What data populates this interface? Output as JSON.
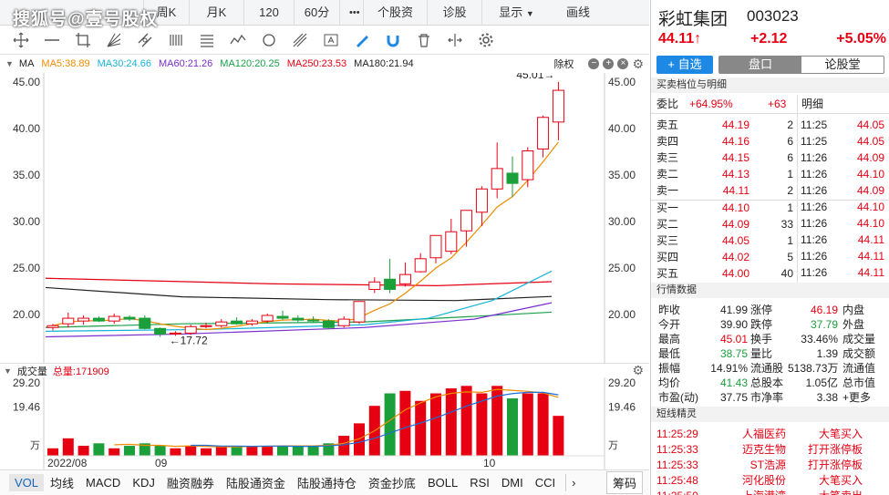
{
  "watermark": "搜狐号@壹号股权",
  "top_tabs": [
    "周K",
    "月K",
    "120分",
    "60分",
    "•••",
    "个股资料",
    "诊股",
    "显示",
    "画线"
  ],
  "ma_legend": [
    {
      "label": "MA",
      "color": "#222"
    },
    {
      "label": "MA5:38.89",
      "color": "#f08c00"
    },
    {
      "label": "MA30:24.66",
      "color": "#16b3d6"
    },
    {
      "label": "MA60:21.26",
      "color": "#7b2fd0"
    },
    {
      "label": "MA120:20.25",
      "color": "#1aa04a"
    },
    {
      "label": "MA250:23.53",
      "color": "#e60012"
    },
    {
      "label": "MA180:21.94",
      "color": "#222"
    }
  ],
  "chu_quan": "除权",
  "price_axis": [
    "45.00",
    "40.00",
    "35.00",
    "30.00",
    "25.00",
    "20.00"
  ],
  "annot_high": "45.01→",
  "annot_low": "←17.72",
  "vol_title": "成交量",
  "vol_total": "总量:171909",
  "vol_axis": [
    "29.20",
    "19.46",
    "万"
  ],
  "x_labels": [
    "2022/08",
    "09",
    "10"
  ],
  "bottom_tabs": [
    "VOL",
    "均线",
    "MACD",
    "KDJ",
    "融资融券",
    "陆股通资金",
    "陆股通持仓",
    "资金抄底",
    "BOLL",
    "RSI",
    "DMI",
    "CCI",
    "筹码"
  ],
  "l2": "L2",
  "stock": {
    "name": "彩虹集团",
    "code": "003023",
    "price": "44.11",
    "arrow": "↑",
    "change": "+2.12",
    "pct": "+5.05%"
  },
  "buttons": {
    "add": "+ 自选",
    "pankou": "盘口",
    "lungu": "论股堂"
  },
  "sections": {
    "orderbook": "买卖档位与明细",
    "market": "行情数据",
    "news": "短线精灵"
  },
  "weibi": {
    "label": "委比",
    "value": "+64.95%",
    "diff": "+63",
    "detail": "明细"
  },
  "sells": [
    {
      "l": "卖五",
      "p": "44.19",
      "v": "2"
    },
    {
      "l": "卖四",
      "p": "44.16",
      "v": "6"
    },
    {
      "l": "卖三",
      "p": "44.15",
      "v": "6"
    },
    {
      "l": "卖二",
      "p": "44.13",
      "v": "1"
    },
    {
      "l": "卖一",
      "p": "44.11",
      "v": "2"
    }
  ],
  "buys": [
    {
      "l": "买一",
      "p": "44.10",
      "v": "1"
    },
    {
      "l": "买二",
      "p": "44.09",
      "v": "33"
    },
    {
      "l": "买三",
      "p": "44.05",
      "v": "1"
    },
    {
      "l": "买四",
      "p": "44.02",
      "v": "5"
    },
    {
      "l": "买五",
      "p": "44.00",
      "v": "40"
    }
  ],
  "ticks": [
    {
      "t": "11:25",
      "p": "44.05"
    },
    {
      "t": "11:25",
      "p": "44.05"
    },
    {
      "t": "11:26",
      "p": "44.09"
    },
    {
      "t": "11:26",
      "p": "44.10"
    },
    {
      "t": "11:26",
      "p": "44.09"
    },
    {
      "t": "11:26",
      "p": "44.10"
    },
    {
      "t": "11:26",
      "p": "44.10"
    },
    {
      "t": "11:26",
      "p": "44.11"
    },
    {
      "t": "11:26",
      "p": "44.11"
    },
    {
      "t": "11:26",
      "p": "44.11"
    }
  ],
  "market": [
    {
      "a": "昨收",
      "av": "41.99",
      "b": "涨停",
      "bv": "46.19",
      "c": "内盘"
    },
    {
      "a": "今开",
      "av": "39.90",
      "b": "跌停",
      "bv": "37.79",
      "c": "外盘"
    },
    {
      "a": "最高",
      "av": "45.01",
      "b": "换手",
      "bv": "33.46%",
      "c": "成交量"
    },
    {
      "a": "最低",
      "av": "38.75",
      "b": "量比",
      "bv": "1.39",
      "c": "成交额"
    },
    {
      "a": "振幅",
      "av": "14.91%",
      "b": "流通股",
      "bv": "5138.73万",
      "c": "流通值"
    },
    {
      "a": "均价",
      "av": "41.43",
      "b": "总股本",
      "bv": "1.05亿",
      "c": "总市值"
    },
    {
      "a": "市盈(动)",
      "av": "37.75",
      "b": "市净率",
      "bv": "3.38",
      "c": "+更多"
    }
  ],
  "news": [
    {
      "t": "11:25:29",
      "n": "人福医药",
      "e": "大笔买入"
    },
    {
      "t": "11:25:33",
      "n": "迈克生物",
      "e": "打开涨停板"
    },
    {
      "t": "11:25:33",
      "n": "ST浩源",
      "e": "打开涨停板"
    },
    {
      "t": "11:25:48",
      "n": "河化股份",
      "e": "大笔买入"
    },
    {
      "t": "11:25:50",
      "n": "上海港湾",
      "e": "大笔卖出"
    }
  ],
  "chart_data": {
    "type": "candlestick",
    "candles": [
      {
        "o": 18.6,
        "h": 19.0,
        "l": 18.3,
        "c": 18.8
      },
      {
        "o": 19.0,
        "h": 20.2,
        "l": 18.6,
        "c": 19.6
      },
      {
        "o": 19.3,
        "h": 19.9,
        "l": 18.9,
        "c": 19.6
      },
      {
        "o": 19.6,
        "h": 19.8,
        "l": 19.2,
        "c": 19.3
      },
      {
        "o": 19.3,
        "h": 20.1,
        "l": 19.0,
        "c": 19.8
      },
      {
        "o": 19.7,
        "h": 19.9,
        "l": 19.3,
        "c": 19.5
      },
      {
        "o": 19.6,
        "h": 19.9,
        "l": 18.4,
        "c": 18.5
      },
      {
        "o": 18.5,
        "h": 18.6,
        "l": 17.6,
        "c": 17.9
      },
      {
        "o": 17.9,
        "h": 18.2,
        "l": 17.7,
        "c": 18.0
      },
      {
        "o": 18.0,
        "h": 18.9,
        "l": 17.8,
        "c": 18.7
      },
      {
        "o": 18.7,
        "h": 19.1,
        "l": 18.5,
        "c": 18.8
      },
      {
        "o": 18.8,
        "h": 19.5,
        "l": 18.6,
        "c": 19.2
      },
      {
        "o": 19.3,
        "h": 19.7,
        "l": 18.9,
        "c": 19.0
      },
      {
        "o": 19.0,
        "h": 19.5,
        "l": 18.8,
        "c": 19.3
      },
      {
        "o": 19.3,
        "h": 20.1,
        "l": 19.1,
        "c": 19.9
      },
      {
        "o": 19.8,
        "h": 20.4,
        "l": 19.4,
        "c": 19.6
      },
      {
        "o": 19.6,
        "h": 19.9,
        "l": 19.2,
        "c": 19.4
      },
      {
        "o": 19.4,
        "h": 19.8,
        "l": 19.1,
        "c": 19.3
      },
      {
        "o": 19.3,
        "h": 19.5,
        "l": 18.4,
        "c": 18.6
      },
      {
        "o": 18.8,
        "h": 19.8,
        "l": 18.6,
        "c": 19.5
      },
      {
        "o": 19.2,
        "h": 21.4,
        "l": 19.0,
        "c": 21.4
      },
      {
        "o": 22.7,
        "h": 24.0,
        "l": 22.3,
        "c": 23.5
      },
      {
        "o": 23.8,
        "h": 26.0,
        "l": 22.3,
        "c": 22.7
      },
      {
        "o": 23.3,
        "h": 25.6,
        "l": 23.0,
        "c": 24.3
      },
      {
        "o": 24.6,
        "h": 26.6,
        "l": 24.5,
        "c": 26.0
      },
      {
        "o": 26.1,
        "h": 27.6,
        "l": 25.5,
        "c": 28.5
      },
      {
        "o": 26.8,
        "h": 30.3,
        "l": 26.5,
        "c": 28.9
      },
      {
        "o": 29.0,
        "h": 31.2,
        "l": 27.3,
        "c": 31.2
      },
      {
        "o": 31.0,
        "h": 33.8,
        "l": 29.5,
        "c": 33.5
      },
      {
        "o": 33.5,
        "h": 38.5,
        "l": 32.5,
        "c": 35.7
      },
      {
        "o": 35.2,
        "h": 37.0,
        "l": 32.6,
        "c": 34.1
      },
      {
        "o": 34.5,
        "h": 38.0,
        "l": 33.7,
        "c": 37.6
      },
      {
        "o": 37.8,
        "h": 41.4,
        "l": 36.9,
        "c": 41.2
      },
      {
        "o": 40.7,
        "h": 45.01,
        "l": 38.75,
        "c": 44.11
      }
    ],
    "volumes": [
      3,
      7,
      4,
      5,
      3,
      4,
      5,
      4,
      3,
      4,
      3,
      4,
      4,
      4,
      4,
      4,
      4,
      4,
      5,
      8,
      13,
      20,
      25,
      26,
      22,
      25,
      27,
      28,
      25,
      28,
      23,
      25,
      25,
      16
    ],
    "ylim": [
      17,
      45
    ],
    "vol_max": 29.2
  }
}
